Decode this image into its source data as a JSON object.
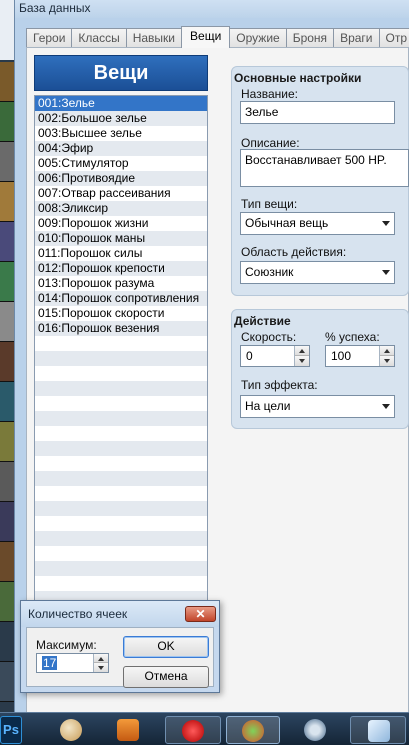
{
  "window": {
    "title": "База данных"
  },
  "tabs": [
    {
      "label": "Герои"
    },
    {
      "label": "Классы"
    },
    {
      "label": "Навыки"
    },
    {
      "label": "Вещи"
    },
    {
      "label": "Оружие"
    },
    {
      "label": "Броня"
    },
    {
      "label": "Враги"
    },
    {
      "label": "Отр"
    }
  ],
  "active_tab": "Вещи",
  "list": {
    "header": "Вещи",
    "items": [
      "001:Зелье",
      "002:Большое зелье",
      "003:Высшее зелье",
      "004:Эфир",
      "005:Стимулятор",
      "006:Противоядие",
      "007:Отвар рассеивания",
      "008:Эликсир",
      "009:Порошок жизни",
      "010:Порошок маны",
      "011:Порошок силы",
      "012:Порошок крепости",
      "013:Порошок разума",
      "014:Порошок сопротивления",
      "015:Порошок скорости",
      "016:Порошок везения"
    ],
    "selected_index": 0
  },
  "basic_settings": {
    "title": "Основные настройки",
    "name_label": "Название:",
    "name_value": "Зелье",
    "description_label": "Описание:",
    "description_value": "Восстанавливает 500 HP.",
    "item_type_label": "Тип вещи:",
    "item_type_value": "Обычная вещь",
    "scope_label": "Область действия:",
    "scope_value": "Союзник"
  },
  "action": {
    "title": "Действие",
    "speed_label": "Скорость:",
    "speed_value": "0",
    "success_label": "% успеха:",
    "success_value": "100",
    "effect_type_label": "Тип эффекта:",
    "effect_type_value": "На цели"
  },
  "dialog": {
    "title": "Количество ячеек",
    "close_label": "✕",
    "max_label": "Максимум:",
    "max_value": "17",
    "ok_label": "OK",
    "cancel_label": "Отмена"
  },
  "taskbar": {
    "ps_label": "Ps"
  },
  "colors": {
    "accent": "#3375c8",
    "header_blue": "#1b4f96",
    "group_bg": "#d7e3ef",
    "close_red": "#c1452a"
  }
}
